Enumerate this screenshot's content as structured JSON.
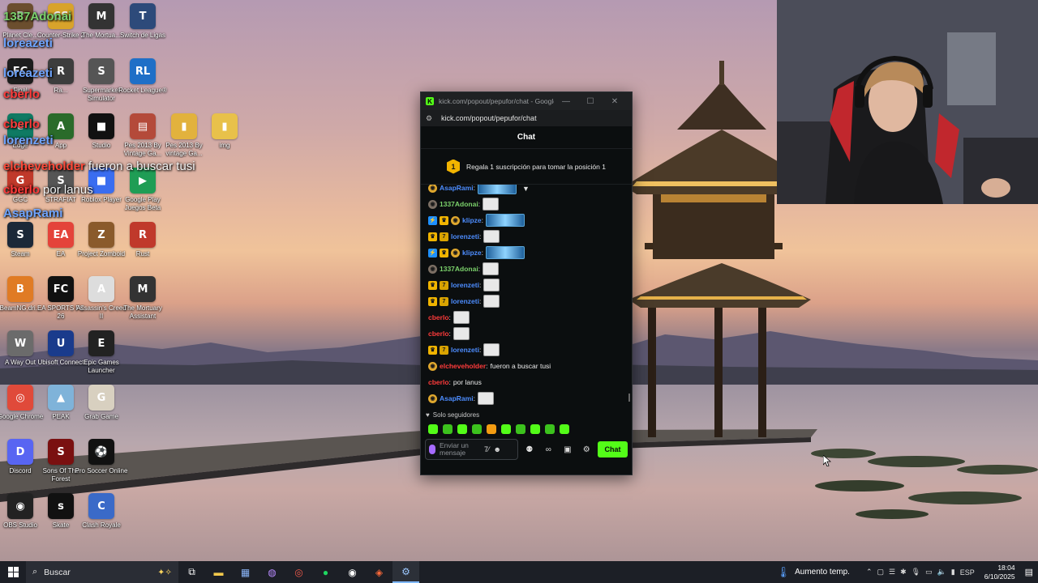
{
  "desktop": {
    "icons": [
      {
        "id": "planet",
        "label": "Planet Cle...",
        "glyph": "P",
        "color": "#6b4e2e"
      },
      {
        "id": "counter-strike",
        "label": "Counter-Strike 2",
        "glyph": "CS",
        "color": "#d8a32b"
      },
      {
        "id": "mortuary",
        "label": "The Mortua...",
        "glyph": "M",
        "color": "#333"
      },
      {
        "id": "switch",
        "label": "Switch de Ligas",
        "glyph": "T",
        "color": "#2d4a7a"
      },
      {
        "id": "fc-final",
        "label": "Final",
        "glyph": "FC",
        "color": "#1d1d1d"
      },
      {
        "id": "ra",
        "label": "Ra...",
        "glyph": "R",
        "color": "#3d3d3d"
      },
      {
        "id": "supermarket",
        "label": "Supermarket Simulator",
        "glyph": "S",
        "color": "#555"
      },
      {
        "id": "rocket-league",
        "label": "Rocket League®",
        "glyph": "RL",
        "color": "#1f6fc7"
      },
      {
        "id": "edge",
        "label": "Edge",
        "glyph": "e",
        "color": "#0f7a63"
      },
      {
        "id": "app",
        "label": "App",
        "glyph": "A",
        "color": "#2a6b2a"
      },
      {
        "id": "roblox-studio",
        "label": "Studio",
        "glyph": "■",
        "color": "#111"
      },
      {
        "id": "pes1",
        "label": "Pes 2013 By Vintage Ga...",
        "glyph": "▤",
        "color": "#b44a3a"
      },
      {
        "id": "pes2",
        "label": "Pes 2013 By vintage Ga...",
        "glyph": "▮",
        "color": "#e2b23d"
      },
      {
        "id": "img",
        "label": "img",
        "glyph": "▮",
        "color": "#e8c14a"
      },
      {
        "id": "ggc",
        "label": "GGC",
        "glyph": "G",
        "color": "#c0392b"
      },
      {
        "id": "strafiat",
        "label": "STRAFIAT",
        "glyph": "S",
        "color": "#555"
      },
      {
        "id": "roblox-player",
        "label": "Roblox Player",
        "glyph": "■",
        "color": "#3a6df0"
      },
      {
        "id": "google-play",
        "label": "Google Play Juegos Beta",
        "glyph": "▶",
        "color": "#1f9d55"
      },
      {
        "id": "steam",
        "label": "Steam",
        "glyph": "S",
        "color": "#1b2838"
      },
      {
        "id": "ea",
        "label": "EA",
        "glyph": "EA",
        "color": "#e4433a"
      },
      {
        "id": "zomboid",
        "label": "Project Zomboid",
        "glyph": "Z",
        "color": "#8a5a2b"
      },
      {
        "id": "rust",
        "label": "Rust",
        "glyph": "R",
        "color": "#c0392b"
      },
      {
        "id": "beamng",
        "label": "BeamNG.dri...",
        "glyph": "B",
        "color": "#e07b24"
      },
      {
        "id": "fc26",
        "label": "EA SPORTS FC 26",
        "glyph": "FC",
        "color": "#111"
      },
      {
        "id": "assassin",
        "label": "Assassin's Creed II",
        "glyph": "A",
        "color": "#ddd"
      },
      {
        "id": "mortuary-assistant",
        "label": "The Mortuary Assistant",
        "glyph": "M",
        "color": "#333"
      },
      {
        "id": "way-out",
        "label": "A Way Out",
        "glyph": "W",
        "color": "#6b6b6b"
      },
      {
        "id": "ubisoft",
        "label": "Ubisoft Connect",
        "glyph": "U",
        "color": "#1a3b8c"
      },
      {
        "id": "epic",
        "label": "Epic Games Launcher",
        "glyph": "E",
        "color": "#222"
      },
      {
        "id": "chrome",
        "label": "Google Chrome",
        "glyph": "◎",
        "color": "#e04a3a"
      },
      {
        "id": "peak",
        "label": "PEAK",
        "glyph": "▲",
        "color": "#7fb3d9"
      },
      {
        "id": "grab",
        "label": "Grab Game",
        "glyph": "G",
        "color": "#d8d0c0"
      },
      {
        "id": "discord",
        "label": "Discord",
        "glyph": "D",
        "color": "#5865f2"
      },
      {
        "id": "sons-forest",
        "label": "Sons Of The Forest",
        "glyph": "S",
        "color": "#7a1010"
      },
      {
        "id": "pro-soccer",
        "label": "Pro Soccer Online",
        "glyph": "⚽",
        "color": "#111"
      },
      {
        "id": "obs",
        "label": "OBS Studio",
        "glyph": "◉",
        "color": "#222"
      },
      {
        "id": "skate",
        "label": "Skate",
        "glyph": "s",
        "color": "#111"
      },
      {
        "id": "clash",
        "label": "Clash Royale",
        "glyph": "C",
        "color": "#3a6ac8"
      }
    ]
  },
  "overlay": [
    {
      "user": "1337Adonai",
      "color": "#7bd16b",
      "text": ""
    },
    {
      "user": "loreazeti",
      "color": "#6fa5ff",
      "text": ""
    },
    {
      "user": "loreazeti",
      "color": "#6fa5ff",
      "text": ""
    },
    {
      "user": "cberlo",
      "color": "#ff3b3b",
      "text": ""
    },
    {
      "user": "cberlo",
      "color": "#ff3b3b",
      "text": ""
    },
    {
      "user": "lorenzeti",
      "color": "#6fa5ff",
      "text": ""
    },
    {
      "user": "elcheveholder",
      "color": "#ff4a3a",
      "text": "fueron a buscar tusi"
    },
    {
      "user": "cberlo",
      "color": "#ff3b3b",
      "text": "por lanus"
    },
    {
      "user": "AsapRami",
      "color": "#6fa5ff",
      "text": ""
    }
  ],
  "chat_window": {
    "title": "kick.com/popout/pepufor/chat - Google...",
    "url": "kick.com/popout/pepufor/chat",
    "header": "Chat",
    "sub_banner": "Regala 1 suscripción para tomar la posición 1",
    "sub_position": "1",
    "messages": [
      {
        "user": "AsapRami",
        "color": "#4d8dff",
        "badges": [
          "coin"
        ],
        "emote": "wide",
        "text": ""
      },
      {
        "user": "1337Adonai",
        "color": "#7bd16b",
        "badges": [
          "grey"
        ],
        "emote": "small",
        "text": ""
      },
      {
        "user": "klipze",
        "color": "#4d8dff",
        "badges": [
          "blue",
          "gold",
          "coin"
        ],
        "emote": "wide",
        "text": ""
      },
      {
        "user": "lorenzeti",
        "color": "#4d8dff",
        "badges": [
          "gold",
          "og"
        ],
        "emote": "small",
        "text": ""
      },
      {
        "user": "klipze",
        "color": "#4d8dff",
        "badges": [
          "blue",
          "gold",
          "coin"
        ],
        "emote": "wide",
        "text": ""
      },
      {
        "user": "1337Adonai",
        "color": "#7bd16b",
        "badges": [
          "grey"
        ],
        "emote": "small",
        "text": ""
      },
      {
        "user": "lorenzeti",
        "color": "#4d8dff",
        "badges": [
          "gold",
          "og"
        ],
        "emote": "small",
        "text": ""
      },
      {
        "user": "lorenzeti",
        "color": "#4d8dff",
        "badges": [
          "gold",
          "og"
        ],
        "emote": "small",
        "text": ""
      },
      {
        "user": "cberlo",
        "color": "#ff3b3b",
        "badges": [],
        "emote": "small",
        "text": ""
      },
      {
        "user": "cberlo",
        "color": "#ff3b3b",
        "badges": [],
        "emote": "small",
        "text": ""
      },
      {
        "user": "lorenzeti",
        "color": "#4d8dff",
        "badges": [
          "gold",
          "og"
        ],
        "emote": "small",
        "text": ""
      },
      {
        "user": "elcheveholder",
        "color": "#ff3b3b",
        "badges": [
          "coin"
        ],
        "emote": "",
        "text": "fueron a buscar tusi"
      },
      {
        "user": "cberlo",
        "color": "#ff3b3b",
        "badges": [],
        "emote": "",
        "text": "por lanus"
      },
      {
        "user": "AsapRami",
        "color": "#4d8dff",
        "badges": [
          "coin"
        ],
        "emote": "small",
        "text": ""
      }
    ],
    "followers_only": "Solo seguidores",
    "input_placeholder": "Enviar un mensaje",
    "send_label": "Chat"
  },
  "taskbar": {
    "search_placeholder": "Buscar",
    "weather": "Aumento temp.",
    "language": "ESP",
    "time": "18:04",
    "date": "6/10/2025"
  }
}
